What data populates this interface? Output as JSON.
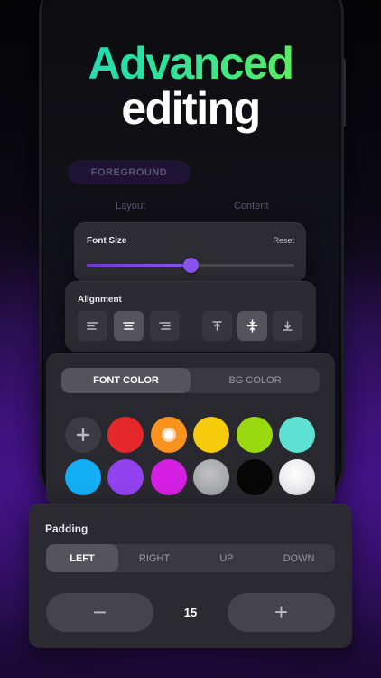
{
  "headline": {
    "line1": "Advanced",
    "line2": "editing"
  },
  "background_ui": {
    "chip": "FOREGROUND",
    "tabs": [
      "Layout",
      "Content"
    ]
  },
  "font_size": {
    "label": "Font Size",
    "reset": "Reset",
    "value_fraction": 0.5
  },
  "alignment": {
    "label": "Alignment",
    "horizontal": [
      "align-left-icon",
      "align-center-icon",
      "align-right-icon"
    ],
    "horizontal_selected": 1,
    "vertical": [
      "align-top-icon",
      "align-middle-icon",
      "align-bottom-icon"
    ],
    "vertical_selected": 1
  },
  "color_panel": {
    "tabs": [
      "FONT COLOR",
      "BG COLOR"
    ],
    "active_tab": 0,
    "add_icon": "plus-icon",
    "selected": "#f7931e",
    "colors": [
      "#e5282b",
      "#f7931e",
      "#f6cb0c",
      "#9ad80f",
      "#5ee0d3",
      "#14aef4",
      "#9242ef",
      "#d51fe2",
      "#a6a7ab",
      "#070707",
      "#f4f4f4"
    ]
  },
  "padding": {
    "label": "Padding",
    "tabs": [
      "LEFT",
      "RIGHT",
      "UP",
      "DOWN"
    ],
    "active_tab": 0,
    "value": "15",
    "minus": "−",
    "plus": "+"
  }
}
